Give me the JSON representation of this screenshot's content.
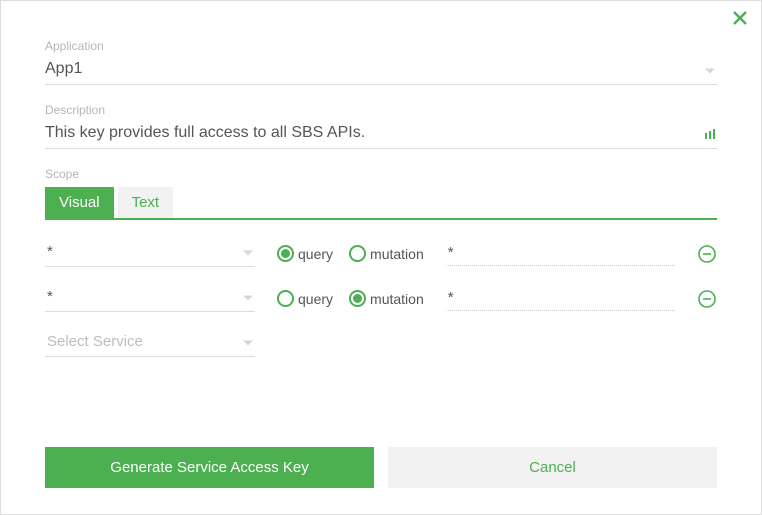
{
  "dialog": {
    "close_icon": "close"
  },
  "fields": {
    "application": {
      "label": "Application",
      "value": "App1"
    },
    "description": {
      "label": "Description",
      "value": "This key provides full access to all SBS APIs."
    },
    "scope": {
      "label": "Scope",
      "tabs": {
        "visual": "Visual",
        "text": "Text"
      },
      "radio_labels": {
        "query": "query",
        "mutation": "mutation"
      },
      "rows": [
        {
          "service": "*",
          "op_selected": "query",
          "method": "*"
        },
        {
          "service": "*",
          "op_selected": "mutation",
          "method": "*"
        }
      ],
      "add_placeholder": "Select Service"
    }
  },
  "buttons": {
    "generate": "Generate Service Access Key",
    "cancel": "Cancel"
  }
}
